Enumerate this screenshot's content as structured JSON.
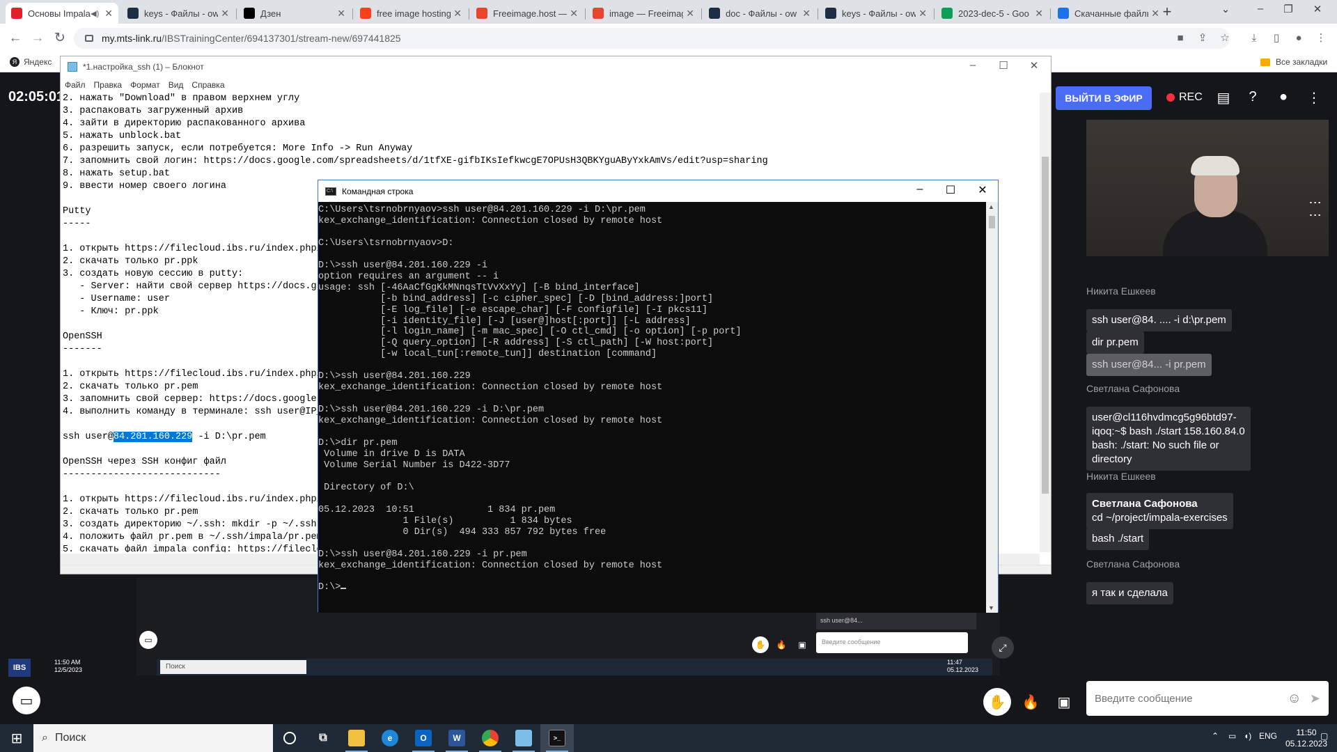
{
  "browser": {
    "tabs": [
      {
        "title": "Основы Impala",
        "icon": "mts-link-icon",
        "color": "#e0202b",
        "active": true
      },
      {
        "title": "keys - Файлы - ow",
        "icon": "owncloud-icon",
        "color": "#1d2d44"
      },
      {
        "title": "Дзен",
        "icon": "dzen-icon",
        "color": "#000000"
      },
      {
        "title": "free image hosting",
        "icon": "yandex-icon",
        "color": "#fc3f1d"
      },
      {
        "title": "Freeimage.host —",
        "icon": "freeimage-icon",
        "color": "#e8442e"
      },
      {
        "title": "image — Freeimage",
        "icon": "freeimage-icon",
        "color": "#e8442e"
      },
      {
        "title": "doc - Файлы - ow",
        "icon": "owncloud-icon",
        "color": "#1d2d44"
      },
      {
        "title": "keys - Файлы - ow",
        "icon": "owncloud-icon",
        "color": "#1d2d44"
      },
      {
        "title": "2023-dec-5 - Goo",
        "icon": "sheets-icon",
        "color": "#0f9d58"
      },
      {
        "title": "Скачанные файлы",
        "icon": "download-icon",
        "color": "#1a73e8"
      }
    ],
    "url_domain": "my.mts-link.ru",
    "url_path": "/IBSTrainingCenter/694137301/stream-new/697441825",
    "bookmark_yandex": "Яндекс",
    "bookmark_all": "Все закладки"
  },
  "webinar": {
    "timer": "02:05:01",
    "live_button": "ВЫЙТИ В ЭФИР",
    "rec_label": "REC",
    "chat_placeholder": "Введите сообщение",
    "messages": [
      {
        "author": "Никита Ешкеев"
      },
      {
        "text": "ssh user@84. .... -i d:\\pr.pem"
      },
      {
        "text": "dir pr.pem"
      },
      {
        "text": "ssh user@84... -i pr.pem",
        "selected": true
      },
      {
        "author": "Светлана Сафонова"
      },
      {
        "lines": [
          "user@cl116hvdmcg5g96btd97-",
          "iqoq:~$ bash ./start 158.160.84.0",
          "bash: ./start: No such file or",
          "directory"
        ]
      },
      {
        "author": "Никита Ешкеев"
      },
      {
        "lines_bold_first": [
          "Светлана Сафонова",
          "cd ~/project/impala-exercises"
        ]
      },
      {
        "text": "bash ./start"
      },
      {
        "author": "Светлана Сафонова"
      },
      {
        "text": "я так и сделала"
      }
    ],
    "shared": {
      "chat_preview": "ssh user@84...",
      "input_placeholder": "Введите сообщение",
      "search_label": "Поиск",
      "ibs_label": "IBS",
      "time": "11:50 AM",
      "date": "12/5/2023",
      "tray_time": "11:47",
      "tray_date": "05.12.2023",
      "tray_lang": "ENG"
    }
  },
  "notepad": {
    "title": "*1.настройка_ssh (1) – Блокнот",
    "menu": [
      "Файл",
      "Правка",
      "Формат",
      "Вид",
      "Справка"
    ],
    "lines": [
      "2. нажать \"Download\" в правом верхнем углу",
      "3. распаковать загруженный архив",
      "4. зайти в директорию распакованного архива",
      "5. нажать unblock.bat",
      "6. разрешить запуск, если потребуется: More Info -> Run Anyway",
      "7. запомнить свой логин: https://docs.google.com/spreadsheets/d/1tfXE-gifbIKsIefkwcgE7OPUsH3QBKYguAByYxkAmVs/edit?usp=sharing",
      "8. нажать setup.bat",
      "9. ввести номер своего логина",
      "",
      "Putty",
      "-----",
      "",
      "1. открыть https://filecloud.ibs.ru/index.php/",
      "2. скачать только pr.ppk",
      "3. создать новую сессию в putty:",
      "   - Server: найти свой сервер https://docs.g",
      "   - Username: user",
      "   - Ключ: pr.ppk",
      "",
      "OpenSSH",
      "-------",
      "",
      "1. открыть https://filecloud.ibs.ru/index.php/",
      "2. скачать только pr.pem",
      "3. запомнить свой сервер: https://docs.google.",
      "4. выполнить команду в терминале: ssh user@IP_",
      "",
      "ssh user@",
      "",
      "OpenSSH через SSH конфиг файл",
      "----------------------------",
      "",
      "1. открыть https://filecloud.ibs.ru/index.php/",
      "2. скачать только pr.pem",
      "3. создать директорию ~/.ssh: mkdir -p ~/.ssh",
      "4. положить файл pr.pem в ~/.ssh/impala/pr.pem",
      "5. скачать файл impala config: https://fileclo"
    ],
    "ssh_prefix": "ssh user@",
    "ssh_highlight": "84.201.160.229",
    "ssh_suffix": " -i D:\\pr.pem"
  },
  "cmd": {
    "title": "Командная строка",
    "lines": [
      "C:\\Users\\tsrnobrnyaov>ssh user@84.201.160.229 -i D:\\pr.pem",
      "kex_exchange_identification: Connection closed by remote host",
      "",
      "C:\\Users\\tsrnobrnyaov>D:",
      "",
      "D:\\>ssh user@84.201.160.229 -i",
      "option requires an argument -- i",
      "usage: ssh [-46AaCfGgKkMNnqsTtVvXxYy] [-B bind_interface]",
      "           [-b bind_address] [-c cipher_spec] [-D [bind_address:]port]",
      "           [-E log_file] [-e escape_char] [-F configfile] [-I pkcs11]",
      "           [-i identity_file] [-J [user@]host[:port]] [-L address]",
      "           [-l login_name] [-m mac_spec] [-O ctl_cmd] [-o option] [-p port]",
      "           [-Q query_option] [-R address] [-S ctl_path] [-W host:port]",
      "           [-w local_tun[:remote_tun]] destination [command]",
      "",
      "D:\\>ssh user@84.201.160.229",
      "kex_exchange_identification: Connection closed by remote host",
      "",
      "D:\\>ssh user@84.201.160.229 -i D:\\pr.pem",
      "kex_exchange_identification: Connection closed by remote host",
      "",
      "D:\\>dir pr.pem",
      " Volume in drive D is DATA",
      " Volume Serial Number is D422-3D77",
      "",
      " Directory of D:\\",
      "",
      "05.12.2023  10:51             1 834 pr.pem",
      "               1 File(s)          1 834 bytes",
      "               0 Dir(s)  494 333 857 792 bytes free",
      "",
      "D:\\>ssh user@84.201.160.229 -i pr.pem",
      "kex_exchange_identification: Connection closed by remote host",
      ""
    ],
    "prompt": "D:\\>"
  },
  "taskbar": {
    "search": "Поиск",
    "apps": [
      "cortana",
      "task-view",
      "explorer",
      "edge",
      "outlook",
      "word",
      "chrome",
      "notepad",
      "cmd"
    ],
    "lang": "ENG",
    "time": "11:50",
    "date": "05.12.2023"
  }
}
